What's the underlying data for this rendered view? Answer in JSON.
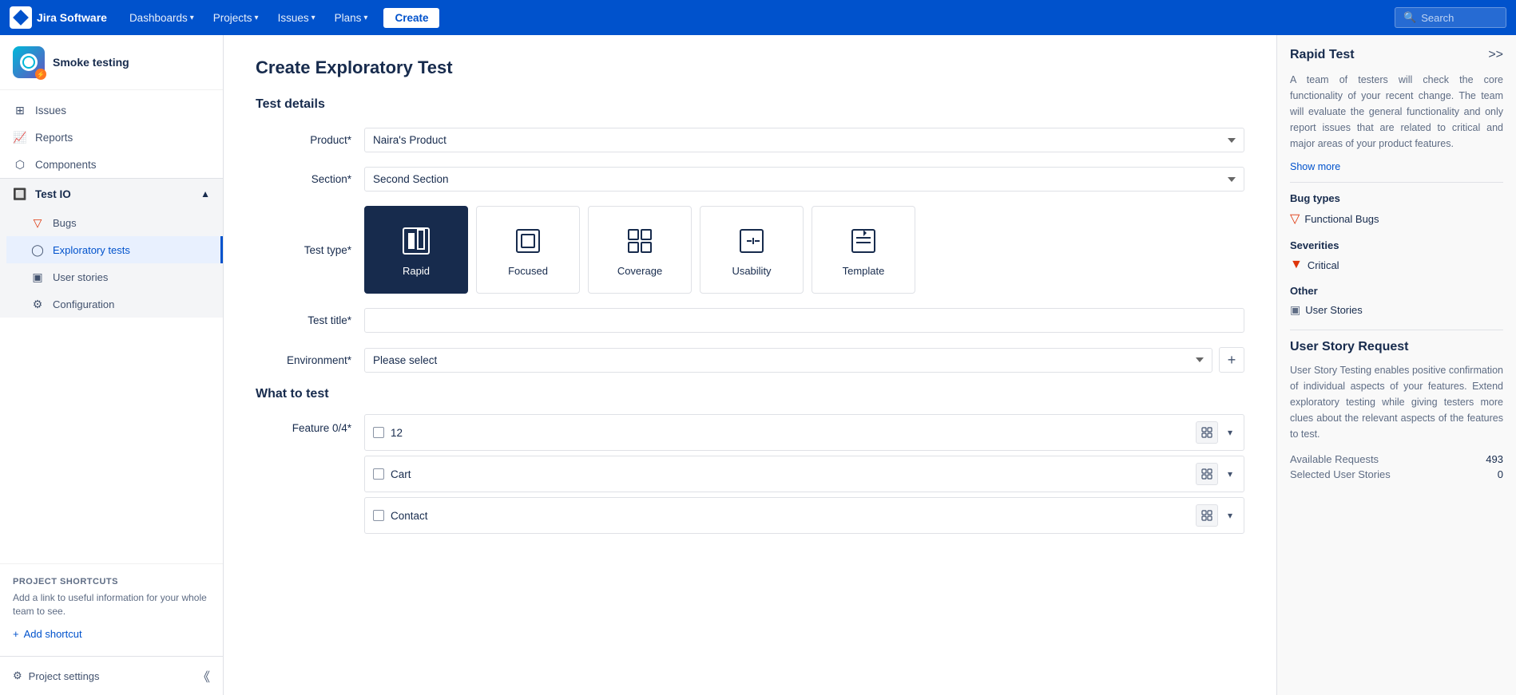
{
  "topnav": {
    "logo": "Jira Software",
    "items": [
      {
        "label": "Dashboards",
        "has_chevron": true
      },
      {
        "label": "Projects",
        "has_chevron": true
      },
      {
        "label": "Issues",
        "has_chevron": true
      },
      {
        "label": "Plans",
        "has_chevron": true
      }
    ],
    "create_label": "Create",
    "search_placeholder": "Search"
  },
  "sidebar": {
    "project_name": "Smoke testing",
    "nav_items": [
      {
        "label": "Issues",
        "icon": "grid"
      },
      {
        "label": "Reports",
        "icon": "chart"
      },
      {
        "label": "Components",
        "icon": "component"
      }
    ],
    "test_io": {
      "label": "Test IO",
      "sub_items": [
        {
          "label": "Bugs",
          "icon": "triangle"
        },
        {
          "label": "Exploratory tests",
          "icon": "circle",
          "active": true
        },
        {
          "label": "User stories",
          "icon": "story"
        },
        {
          "label": "Configuration",
          "icon": "gear"
        }
      ]
    },
    "shortcuts_title": "PROJECT SHORTCUTS",
    "shortcuts_desc": "Add a link to useful information for your whole team to see.",
    "add_shortcut": "Add shortcut",
    "project_settings": "Project settings"
  },
  "main": {
    "title": "Create Exploratory Test",
    "test_details_label": "Test details",
    "product_label": "Product*",
    "product_value": "Naira's Product",
    "section_label": "Section*",
    "section_value": "Second Section",
    "test_type_label": "Test type*",
    "test_types": [
      {
        "id": "rapid",
        "label": "Rapid",
        "selected": true
      },
      {
        "id": "focused",
        "label": "Focused",
        "selected": false
      },
      {
        "id": "coverage",
        "label": "Coverage",
        "selected": false
      },
      {
        "id": "usability",
        "label": "Usability",
        "selected": false
      },
      {
        "id": "template",
        "label": "Template",
        "selected": false
      }
    ],
    "test_title_label": "Test title*",
    "test_title_placeholder": "",
    "environment_label": "Environment*",
    "environment_placeholder": "Please select",
    "what_to_test": "What to test",
    "feature_label": "Feature 0/4*",
    "features": [
      {
        "name": "12"
      },
      {
        "name": "Cart"
      },
      {
        "name": "Contact"
      }
    ]
  },
  "right_panel": {
    "title": "Rapid Test",
    "collapse_icon": ">>",
    "description": "A team of testers will check the core functionality of your recent change. The team will evaluate the general functionality and only report issues that are related to critical and major areas of your product features.",
    "show_more": "Show more",
    "bug_types_label": "Bug types",
    "bug_types": [
      {
        "label": "Functional Bugs",
        "icon": "triangle-red"
      }
    ],
    "severities_label": "Severities",
    "severities": [
      {
        "label": "Critical",
        "icon": "severity-red"
      }
    ],
    "other_label": "Other",
    "other_items": [
      {
        "label": "User Stories",
        "icon": "grid"
      }
    ],
    "user_story_title": "User Story Request",
    "user_story_desc": "User Story Testing enables positive confirmation of individual aspects of your features. Extend exploratory testing while giving testers more clues about the relevant aspects of the features to test.",
    "available_requests_label": "Available Requests",
    "available_requests_value": "493",
    "selected_stories_label": "Selected User Stories",
    "selected_stories_value": "0"
  }
}
